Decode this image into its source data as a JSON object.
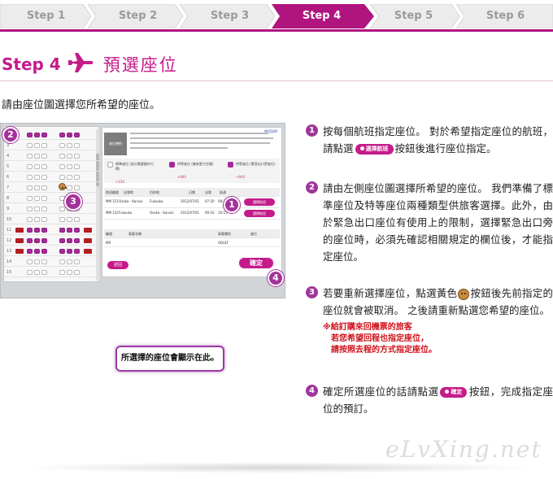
{
  "steps": {
    "items": [
      "Step 1",
      "Step 2",
      "Step 3",
      "Step 4",
      "Step 5",
      "Step 6"
    ],
    "active_index": 3,
    "active_color": "#b0147e",
    "inactive_color": "#ececec"
  },
  "heading": {
    "step_label": "Step 4",
    "title": "預選座位",
    "icon": "airplane-icon",
    "accent_color": "#c51b8a"
  },
  "intro": "請由座位圖選擇您所希望的座位。",
  "screenshot": {
    "seat_row_numbers": [
      "2",
      "3",
      "4",
      "5",
      "6",
      "7",
      "8",
      "9",
      "10",
      "11",
      "12",
      "13",
      "14",
      "15"
    ],
    "info_label": "座位預約",
    "help_link": "使用說明",
    "legend": [
      {
        "label": "標準座位 (部分需要額外付費)",
        "price": "+210"
      },
      {
        "label": "特等座位 (擁有更大空間)",
        "price": "+840"
      },
      {
        "label": "特等座位 (緊急出口旁座位)",
        "price": "+840"
      }
    ],
    "flight_headers": [
      "航班編號",
      "出發地",
      "目的地",
      "日期",
      "出發",
      "抵達"
    ],
    "flights": [
      {
        "no": "MM 151",
        "from": "Osaka - Kansai",
        "to": "Fukuoka",
        "date": "2012/07/01",
        "dep": "07:20",
        "arr": "08:25"
      },
      {
        "no": "MM 152",
        "from": "Fukuoka",
        "to": "Osaka - Kansai",
        "date": "2012/07/01",
        "dep": "09:10",
        "arr": "10:15"
      }
    ],
    "select_flight_button": "選擇航班",
    "passenger_headers": [
      "編號",
      "乘客名稱",
      "乘客類別",
      "座位"
    ],
    "passenger_row": {
      "id": "MR",
      "type": "ADULT"
    },
    "back_button": "返回",
    "confirm_button": "確定",
    "callout": "所選擇的座位會顯示在此。",
    "badges": [
      "1",
      "2",
      "3",
      "4"
    ]
  },
  "instructions": [
    {
      "number": "1",
      "before": "按每個航班指定座位。 對於希望指定座位的航班，請點選",
      "button": "選擇航班",
      "after": "按鈕後進行座位指定。"
    },
    {
      "number": "2",
      "text": "請由左側座位圖選擇所希望的座位。 我們準備了標準座位及特等座位兩種類型供旅客選擇。此外，由於緊急出口座位有使用上的限制，選擇緊急出口旁的座位時，必須先確認相關規定的欄位後，才能指定座位。"
    },
    {
      "number": "3",
      "before": "若要重新選擇座位，點選黃色",
      "after": "按鈕後先前指定的座位就會被取消。 之後請重新點選您希望的座位。",
      "note": [
        "※給訂購來回機票的旅客",
        "若您希望回程也指定座位，",
        "請按照去程的方式指定座位。"
      ]
    },
    {
      "number": "4",
      "before": "確定所選座位的話請點選",
      "button": "確定",
      "after": "按鈕，完成指定座位的預訂。"
    }
  ],
  "watermark": "eLvXing.net"
}
